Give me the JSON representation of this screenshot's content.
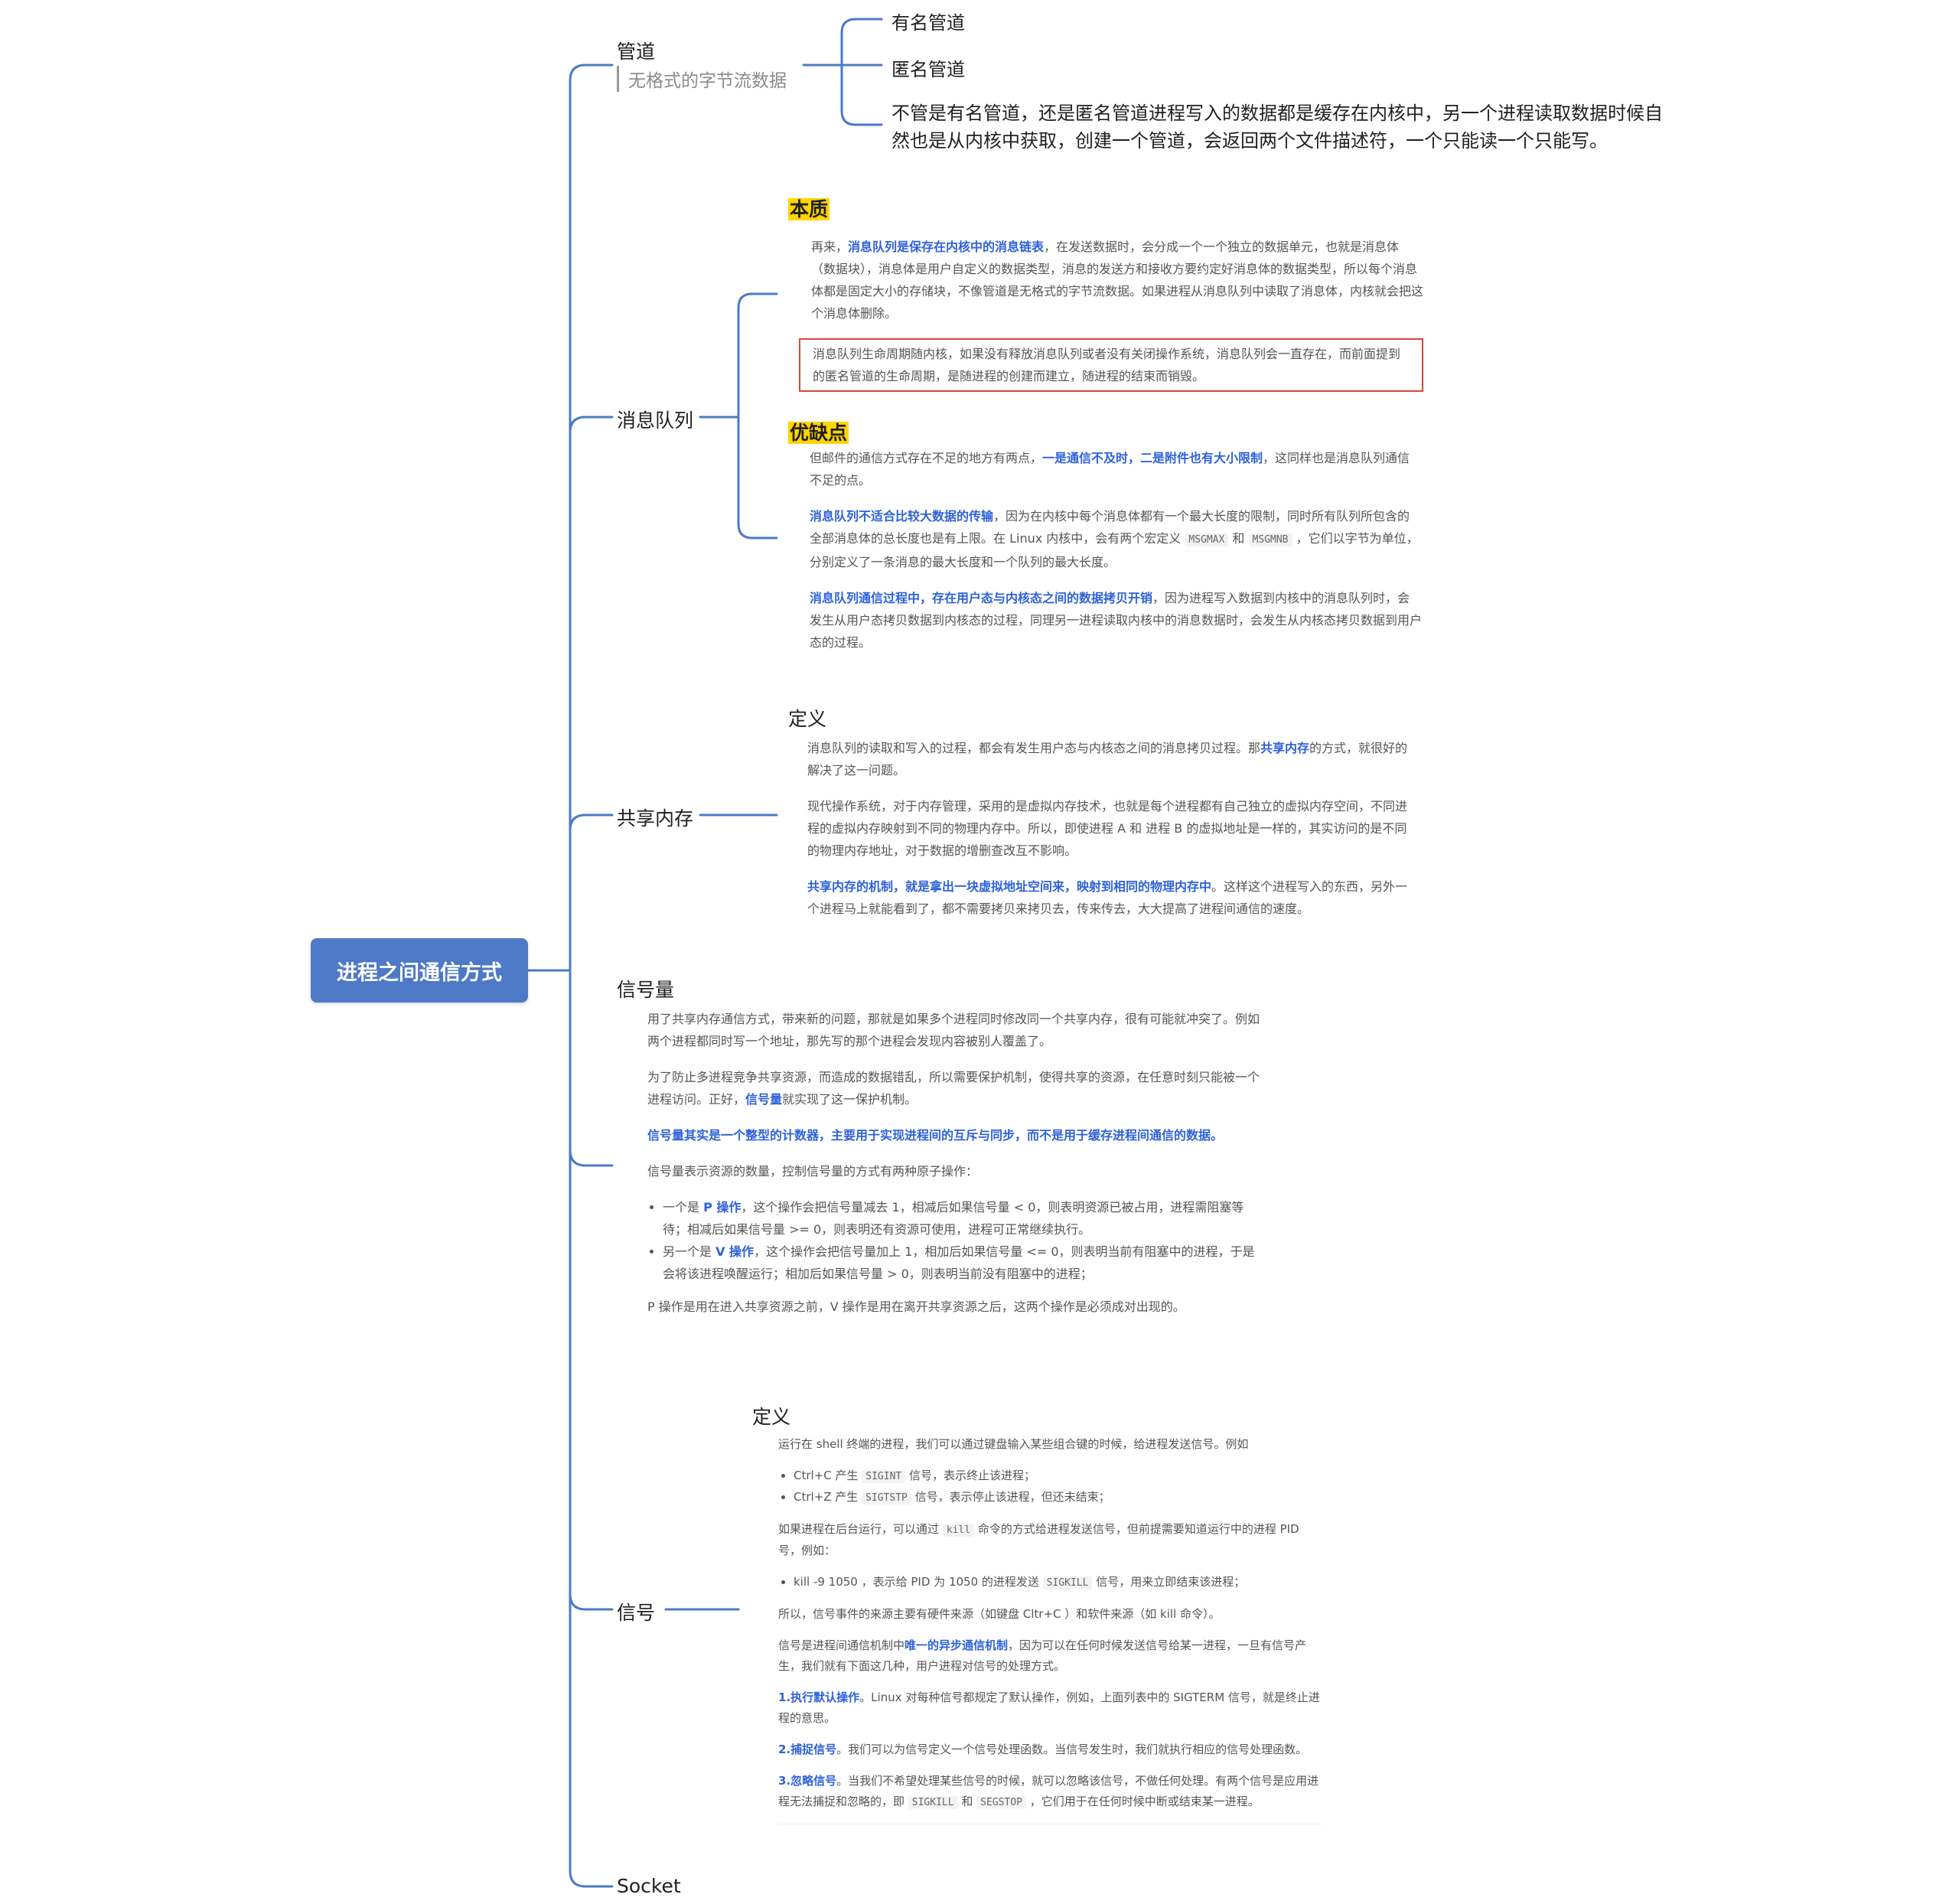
{
  "root": {
    "label": "进程之间通信方式"
  },
  "pipe": {
    "label": "管道",
    "note": "无格式的字节流数据",
    "children": [
      "有名管道",
      "匿名管道"
    ],
    "detail": "不管是有名管道，还是匿名管道进程写入的数据都是缓存在内核中，另一个进程读取数据时候自然也是从内核中获取，创建一个管道，会返回两个文件描述符，一个只能读一个只能写。"
  },
  "mq": {
    "label": "消息队列",
    "essence_title": "本质",
    "p1_a": "再来，",
    "p1_b": "消息队列是保存在内核中的消息链表",
    "p1_c": "，在发送数据时，会分成一个一个独立的数据单元，也就是消息体（数据块），消息体是用户自定义的数据类型，消息的发送方和接收方要约定好消息体的数据类型，所以每个消息体都是固定大小的存储块，不像管道是无格式的字节流数据。如果进程从消息队列中读取了消息体，内核就会把这个消息体删除。",
    "p2": "消息队列生命周期随内核，如果没有释放消息队列或者没有关闭操作系统，消息队列会一直存在，而前面提到的匿名管道的生命周期，是随进程的创建而建立，随进程的结束而销毁。",
    "pros_title": "优缺点",
    "p3_a": "但邮件的通信方式存在不足的地方有两点，",
    "p3_b": "一是通信不及时，二是附件也有大小限制",
    "p3_c": "，这同样也是消息队列通信不足的点。",
    "p4_a": "消息队列不适合比较大数据的传输",
    "p4_b": "，因为在内核中每个消息体都有一个最大长度的限制，同时所有队列所包含的全部消息体的总长度也是有上限。在 Linux 内核中，会有两个宏定义 ",
    "p4_code1": "MSGMAX",
    "p4_c": " 和 ",
    "p4_code2": "MSGMNB",
    "p4_d": " ，它们以字节为单位，分别定义了一条消息的最大长度和一个队列的最大长度。",
    "p5_a": "消息队列通信过程中，存在用户态与内核态之间的数据拷贝开销",
    "p5_b": "，因为进程写入数据到内核中的消息队列时，会发生从用户态拷贝数据到内核态的过程，同理另一进程读取内核中的消息数据时，会发生从内核态拷贝数据到用户态的过程。"
  },
  "shm": {
    "label": "共享内存",
    "def_title": "定义",
    "p1_a": "消息队列的读取和写入的过程，都会有发生用户态与内核态之间的消息拷贝过程。那",
    "p1_b": "共享内存",
    "p1_c": "的方式，就很好的解决了这一问题。",
    "p2": "现代操作系统，对于内存管理，采用的是虚拟内存技术，也就是每个进程都有自己独立的虚拟内存空间，不同进程的虚拟内存映射到不同的物理内存中。所以，即使进程 A 和 进程 B 的虚拟地址是一样的，其实访问的是不同的物理内存地址，对于数据的增删查改互不影响。",
    "p3_a": "共享内存的机制，就是拿出一块虚拟地址空间来，映射到相同的物理内存中",
    "p3_b": "。这样这个进程写入的东西，另外一个进程马上就能看到了，都不需要拷贝来拷贝去，传来传去，大大提高了进程间通信的速度。"
  },
  "sem": {
    "label": "信号量",
    "p1": "用了共享内存通信方式，带来新的问题，那就是如果多个进程同时修改同一个共享内存，很有可能就冲突了。例如两个进程都同时写一个地址，那先写的那个进程会发现内容被别人覆盖了。",
    "p2_a": "为了防止多进程竞争共享资源，而造成的数据错乱，所以需要保护机制，使得共享的资源，在任意时刻只能被一个进程访问。正好，",
    "p2_b": "信号量",
    "p2_c": "就实现了这一保护机制。",
    "p3": "信号量其实是一个整型的计数器，主要用于实现进程间的互斥与同步，而不是用于缓存进程间通信的数据。",
    "p4": "信号量表示资源的数量，控制信号量的方式有两种原子操作：",
    "li1_a": "一个是 ",
    "li1_b": "P 操作",
    "li1_c": "，这个操作会把信号量减去 1，相减后如果信号量 < 0，则表明资源已被占用，进程需阻塞等待；相减后如果信号量 >= 0，则表明还有资源可使用，进程可正常继续执行。",
    "li2_a": "另一个是 ",
    "li2_b": "V 操作",
    "li2_c": "，这个操作会把信号量加上 1，相加后如果信号量 <= 0，则表明当前有阻塞中的进程，于是会将该进程唤醒运行；相加后如果信号量 > 0，则表明当前没有阻塞中的进程；",
    "p5": "P 操作是用在进入共享资源之前，V 操作是用在离开共享资源之后，这两个操作是必须成对出现的。"
  },
  "signal": {
    "label": "信号",
    "def_title": "定义",
    "p1": "运行在 shell 终端的进程，我们可以通过键盘输入某些组合键的时候，给进程发送信号。例如",
    "li1_a": "Ctrl+C 产生 ",
    "li1_code": "SIGINT",
    "li1_b": " 信号，表示终止该进程；",
    "li2_a": "Ctrl+Z 产生 ",
    "li2_code": "SIGTSTP",
    "li2_b": " 信号，表示停止该进程，但还未结束；",
    "p2_a": "如果进程在后台运行，可以通过 ",
    "p2_code": "kill",
    "p2_b": " 命令的方式给进程发送信号，但前提需要知道运行中的进程 PID 号，例如：",
    "li3_a": "kill -9 1050 ，表示给 PID 为 1050 的进程发送 ",
    "li3_code": "SIGKILL",
    "li3_b": " 信号，用来立即结束该进程；",
    "p3": "所以，信号事件的来源主要有硬件来源（如键盘 Cltr+C ）和软件来源（如 kill 命令）。",
    "p4_a": "信号是进程间通信机制中",
    "p4_b": "唯一的异步通信机制",
    "p4_c": "，因为可以在任何时候发送信号给某一进程，一旦有信号产生，我们就有下面这几种，用户进程对信号的处理方式。",
    "p5_a": "1.执行默认操作",
    "p5_b": "。Linux 对每种信号都规定了默认操作，例如，上面列表中的 SIGTERM 信号，就是终止进程的意思。",
    "p6_a": "2.捕捉信号",
    "p6_b": "。我们可以为信号定义一个信号处理函数。当信号发生时，我们就执行相应的信号处理函数。",
    "p7_a": "3.忽略信号",
    "p7_b": "。当我们不希望处理某些信号的时候，就可以忽略该信号，不做任何处理。有两个信号是应用进程无法捕捉和忽略的，即 ",
    "p7_code1": "SIGKILL",
    "p7_c": " 和 ",
    "p7_code2": "SEGSTOP",
    "p7_d": " ，它们用于在任何时候中断或结束某一进程。"
  },
  "socket": {
    "label": "Socket"
  },
  "colors": {
    "line": "#4d79c7",
    "root": "#4d79c7",
    "highlight": "#ffd400",
    "link": "#2e62d9",
    "box": "#d6473a"
  }
}
